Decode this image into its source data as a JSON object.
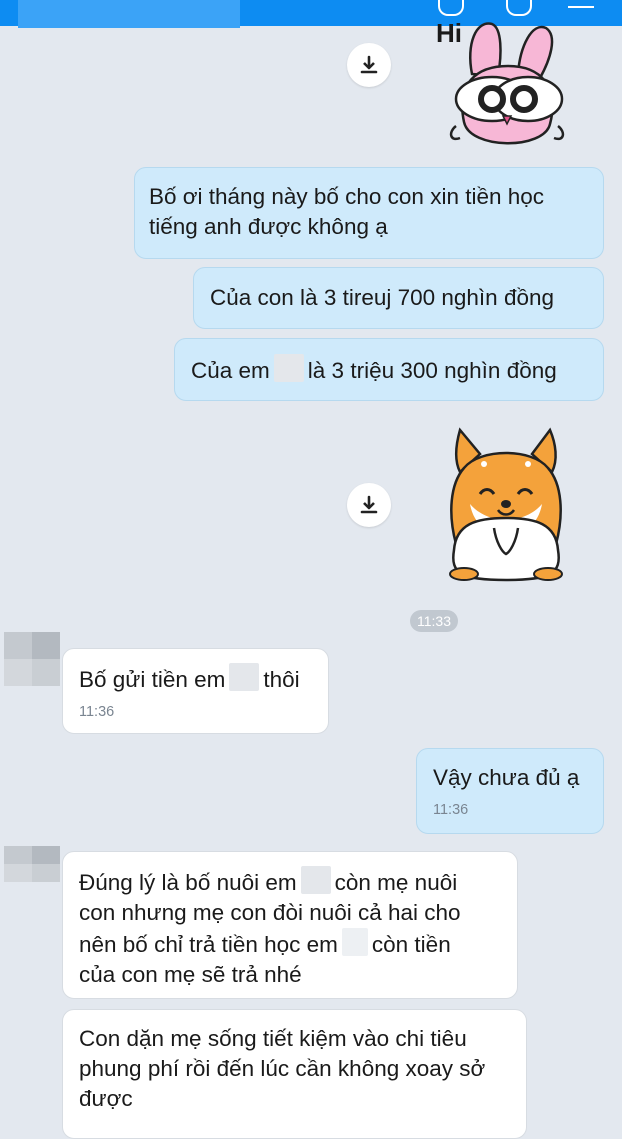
{
  "header": {
    "background": "#0d8cf2"
  },
  "stickers": [
    {
      "name": "hi-bunny-sticker",
      "caption": "Hi"
    },
    {
      "name": "shiba-dog-sticker"
    }
  ],
  "messages": {
    "m1": {
      "text": "Bố ơi tháng này bố cho con xin tiền học tiếng anh được không ạ"
    },
    "m2": {
      "text": "Của con là 3 tireuj 700 nghìn đồng"
    },
    "m3": {
      "text_before": "Của em",
      "text_after": "là 3 triệu 300 nghìn đồng"
    },
    "time_divider": "11:33",
    "m4": {
      "text_before": "Bố gửi tiền em",
      "text_after": "thôi",
      "time": "11:36"
    },
    "m5": {
      "text": "Vậy chưa đủ ạ",
      "time": "11:36"
    },
    "m6": {
      "line1_before": "Đúng lý là bố nuôi em",
      "line1_after": "còn mẹ nuôi",
      "line2": "con nhưng mẹ con đòi nuôi cả hai cho",
      "line3_before": "nên bố chỉ trả tiền học em",
      "line3_after": "còn tiền",
      "line4": "của con mẹ sẽ trả nhé"
    },
    "m7": {
      "text": "Con dặn mẹ sống tiết kiệm vào chi tiêu phung phí rồi đến lúc cần không xoay sở được"
    }
  },
  "colors": {
    "my_bubble": "#cfeafb",
    "their_bubble": "#ffffff",
    "chat_background": "#e3e8ef"
  }
}
